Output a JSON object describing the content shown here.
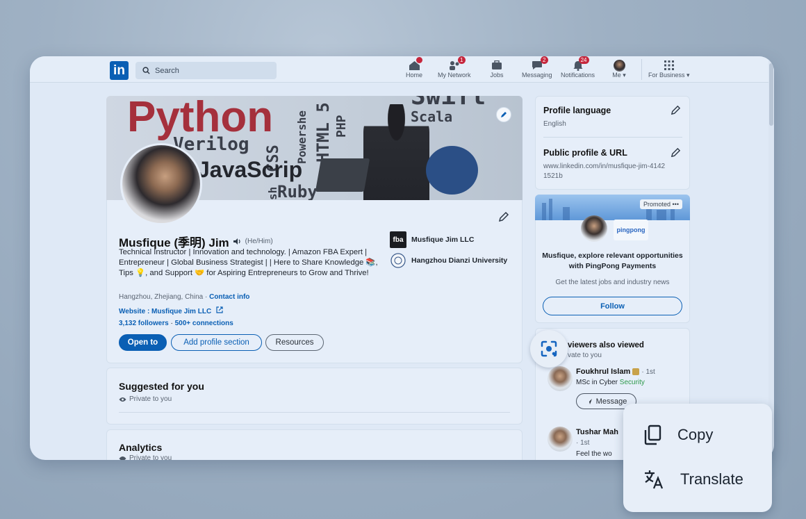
{
  "nav": {
    "logo": "in",
    "search_placeholder": "Search",
    "items": [
      {
        "label": "Home",
        "badge": ""
      },
      {
        "label": "My Network",
        "badge": "1"
      },
      {
        "label": "Jobs",
        "badge": ""
      },
      {
        "label": "Messaging",
        "badge": "2"
      },
      {
        "label": "Notifications",
        "badge": "24"
      },
      {
        "label": "Me",
        "badge": ""
      },
      {
        "label": "For Business",
        "badge": ""
      }
    ]
  },
  "banner": {
    "words": [
      "Python",
      "Verilog",
      "CSS",
      "Powershe",
      "HTML 5",
      "PHP",
      "JavaScrip",
      "Ruby",
      "sh",
      "Scala",
      "Swift"
    ]
  },
  "profile": {
    "name": "Musfique (季明) Jim",
    "pronouns": "(He/Him)",
    "headline": "Technical Instructor | Innovation and technology. | Amazon FBA Expert | Entrepreneur | Global Business Strategist | | Here to Share Knowledge 📚, Tips 💡, and Support 🤝 for Aspiring Entrepreneurs to Grow and Thrive!",
    "location": "Hangzhou, Zhejiang, China",
    "contact_label": "Contact info",
    "website_label": "Website : Musfique Jim LLC",
    "followers": "3,132 followers",
    "connections": "500+ connections",
    "buttons": {
      "open_to": "Open to",
      "add_section": "Add profile section",
      "resources": "Resources"
    },
    "orgs": [
      {
        "logo": "fba",
        "name": "Musfique Jim LLC"
      },
      {
        "logo": "",
        "name": "Hangzhou Dianzi University"
      }
    ]
  },
  "suggested": {
    "title": "Suggested for you",
    "private": "Private to you"
  },
  "analytics": {
    "title": "Analytics",
    "private": "Private to you"
  },
  "sidebar": {
    "profile_language": {
      "title": "Profile language",
      "value": "English"
    },
    "public_profile": {
      "title": "Public profile & URL",
      "value": "www.linkedin.com/in/musfique-jim-41421521b"
    },
    "promo": {
      "tag": "Promoted",
      "brand": "pingpong",
      "headline": "Musfique, explore relevant opportunities with PingPong Payments",
      "sub": "Get the latest jobs and industry news",
      "follow": "Follow"
    },
    "viewers": {
      "title": "viewers also viewed",
      "private": "vate to you",
      "people": [
        {
          "name": "Foukhrul Islam",
          "degree": "· 1st",
          "desc_a": "MSc in Cyber ",
          "desc_b": "Security",
          "action": "Message"
        },
        {
          "name": "Tushar Mah",
          "degree": "· 1st",
          "desc_a": "Feel the wo",
          "desc_b": "",
          "action": ""
        }
      ]
    }
  },
  "context_menu": {
    "copy": "Copy",
    "translate": "Translate"
  }
}
